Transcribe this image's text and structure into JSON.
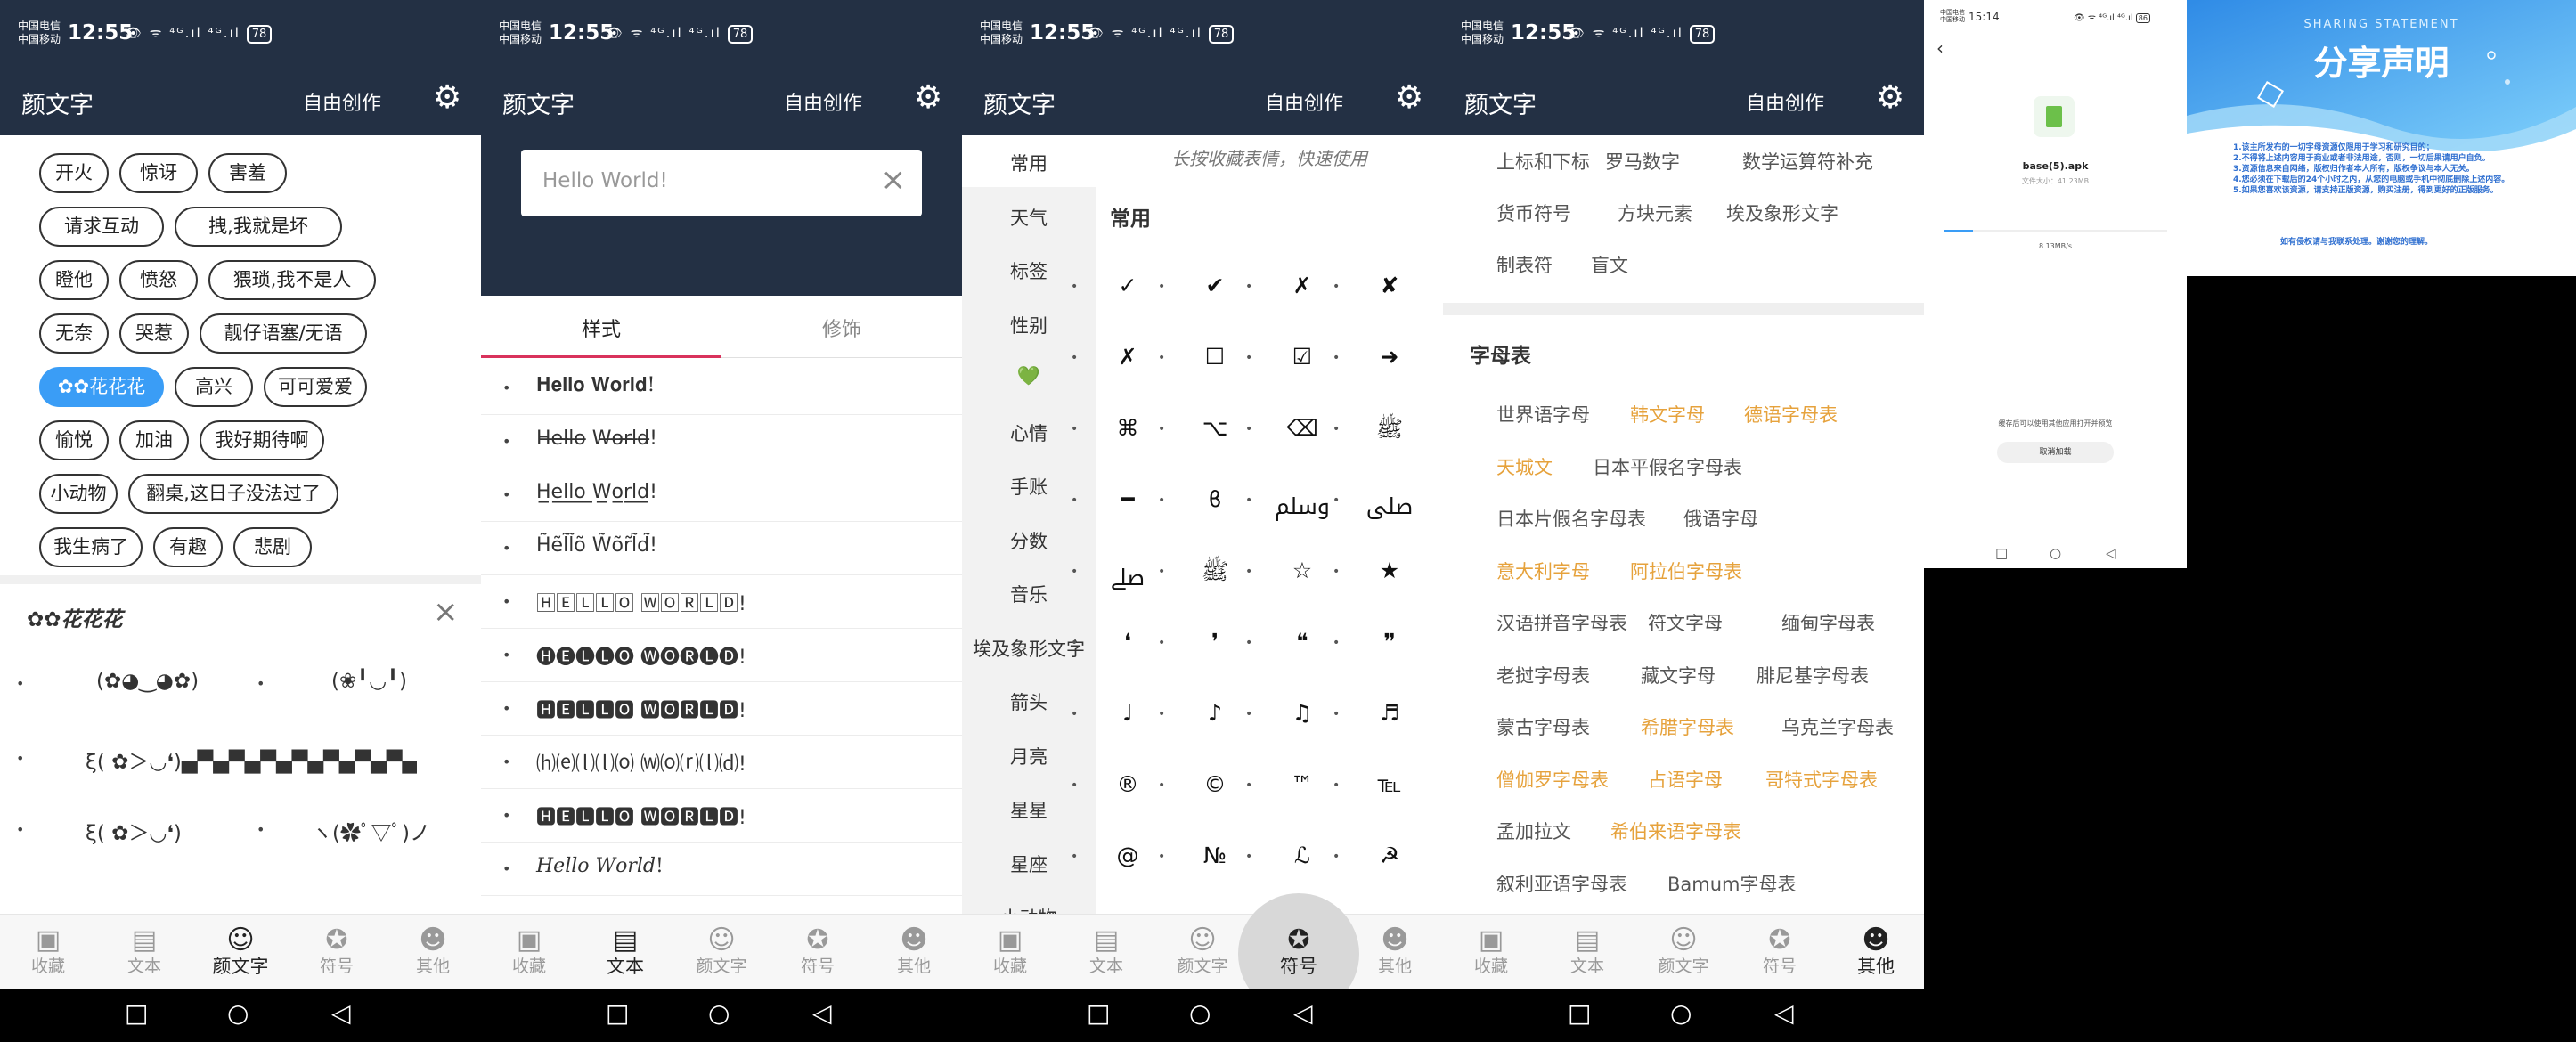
{
  "status": {
    "carrier": "中国电信\n中国移动",
    "time": "12:55",
    "speed1": "4.6\nK/s",
    "speed2": "0.9\nM/s",
    "speed3": "0\nK/s",
    "speed4": "0\nK/s",
    "signal": "👁 ᯤ ⁴ᴳ.ıl ⁴ᴳ.ıl",
    "battery": "78"
  },
  "header": {
    "title": "颜文字",
    "free_create": "自由创作",
    "gear_icon": "⚙"
  },
  "bottom_nav": [
    {
      "label": "收藏",
      "icon": "▣"
    },
    {
      "label": "文本",
      "icon": "▤"
    },
    {
      "label": "颜文字",
      "icon": "☺"
    },
    {
      "label": "符号",
      "icon": "✪"
    },
    {
      "label": "其他",
      "icon": "☻"
    }
  ],
  "sys_nav": {
    "square": "□",
    "circle": "○",
    "back": "◁"
  },
  "screen1": {
    "chips": [
      "开火",
      "惊讶",
      "害羞",
      "请求互动",
      "拽,我就是坏",
      "瞪他",
      "愤怒",
      "猥琐,我不是人",
      "无奈",
      "哭惹",
      "靓仔语塞/无语",
      "✿✿花花花",
      "高兴",
      "可可爱爱",
      "愉悦",
      "加油",
      "我好期待啊",
      "小动物",
      "翻桌,这日子没法过了",
      "我生病了",
      "有趣",
      "悲剧"
    ],
    "panel_title": "✿✿花花花",
    "close": "×",
    "items": [
      "(✿◕‿◕✿)",
      "(❀╹◡╹)",
      "ξ( ✿＞◡❛)▄▀▄▀▄▀▄▀▄▀▄▀▄▀▄",
      "ξ( ✿＞◡❛)",
      "ヽ(✿ﾟ▽ﾟ)ノ"
    ]
  },
  "screen2": {
    "input_value": "Hello World!",
    "clear": "×",
    "tabs": [
      "样式",
      "修饰"
    ],
    "styles": [
      "𝐇𝐞𝐥𝐥𝐨 𝐖𝐨𝐫𝐥𝐝!",
      "H̶e̶l̶l̶o̶ W̶o̶r̶l̶d̶!",
      "H̲e̲l̲l̲o̲ ̲W̲o̲r̲l̲d̲!",
      "H̃ẽl̃l̃õ W̃õr̃l̃d̃!",
      "🄷🄴🄻🄻🄾 🅆🄾🅁🄻🄳!",
      "🅗🅔🅛🅛🅞 🅦🅞🅡🅛🅓!",
      "🅷🅴🅻🅻🅾 🆆🅾🆁🅻🅳!",
      "⒣⒠⒧⒧⒪ ⒲⒪⒭⒧⒟!",
      "🅷🅴🅻🅻🅾 🆆🅾🆁🅻🅳!",
      "𝐻𝑒𝑙𝑙𝑜 𝑊𝑜𝑟𝑙𝑑!"
    ]
  },
  "screen3": {
    "hint": "长按收藏表情，快速使用",
    "categories": [
      "常用",
      "天气",
      "标签",
      "性别",
      "💚",
      "心情",
      "手账",
      "分数",
      "音乐",
      "埃及象形文字",
      "箭头",
      "月亮",
      "星星",
      "星座",
      "小动物"
    ],
    "section": "常用",
    "symbols": [
      "✓",
      "✔",
      "✗",
      "✘",
      "✗",
      "☐",
      "☑",
      "➜",
      "⌘",
      "⌥",
      "⌫",
      "ﷺ",
      "━",
      "ϐ",
      "ﷸ",
      "ﷹ",
      "ﷰ",
      "ﷺ",
      "☆",
      "★",
      "❛",
      "❜",
      "❝",
      "❞",
      "♩",
      "♪",
      "♫",
      "♬",
      "®",
      "©",
      "™",
      "℡",
      "@",
      "№",
      "ℒ",
      "☭",
      "Ɀ",
      "ℬ",
      "☯",
      "☏"
    ]
  },
  "screen4": {
    "top_links": [
      "上标和下标",
      "罗马数字",
      "数学运算符补充",
      "货币符号",
      "方块元素",
      "埃及象形文字",
      "制表符",
      "盲文"
    ],
    "section": "字母表",
    "links": [
      {
        "t": "世界语字母",
        "o": false
      },
      {
        "t": "韩文字母",
        "o": true
      },
      {
        "t": "德语字母表",
        "o": true
      },
      {
        "t": "天城文",
        "o": true
      },
      {
        "t": "日本平假名字母表",
        "o": false
      },
      {
        "t": "日本片假名字母表",
        "o": false
      },
      {
        "t": "俄语字母",
        "o": false
      },
      {
        "t": "意大利字母",
        "o": true
      },
      {
        "t": "阿拉伯字母表",
        "o": true
      },
      {
        "t": "汉语拼音字母表",
        "o": false
      },
      {
        "t": "符文字母",
        "o": false
      },
      {
        "t": "缅甸字母表",
        "o": false
      },
      {
        "t": "老挝字母表",
        "o": false
      },
      {
        "t": "藏文字母",
        "o": false
      },
      {
        "t": "腓尼基字母表",
        "o": false
      },
      {
        "t": "蒙古字母表",
        "o": false
      },
      {
        "t": "希腊字母表",
        "o": true
      },
      {
        "t": "乌克兰字母表",
        "o": false
      },
      {
        "t": "僧伽罗字母表",
        "o": true
      },
      {
        "t": "占语字母",
        "o": true
      },
      {
        "t": "哥特式字母表",
        "o": true
      },
      {
        "t": "孟加拉文",
        "o": false
      },
      {
        "t": "希伯来语字母表",
        "o": true
      },
      {
        "t": "叙利亚语字母表",
        "o": false
      },
      {
        "t": "Bamum字母表",
        "o": false
      }
    ]
  },
  "screen5": {
    "status_time": "15:14",
    "carrier": "中国电信\n中国移动",
    "battery": "86",
    "back": "‹",
    "file_name": "base(5).apk",
    "file_size": "文件大小：41.23MB",
    "speed": "8.13MB/s",
    "notice": "缓存后可以使用其他应用打开并预览",
    "cancel": "取消加载",
    "download_progress": 0.13
  },
  "screen6": {
    "en_title": "SHARING STATEMENT",
    "title": "分享声明",
    "lines": [
      "1.该主所发布的一切字母资源仅限用于学习和研究目的；",
      "2.不得将上述内容用于商业或者非法用途，否则，一切后果请用户自负。",
      "3.资源信息来自网络，版权归作者本人所有，版权争议与本人无关。",
      "4.您必须在下载后的24个小时之内，从您的电脑或手机中彻底删除上述内容。",
      "5.如果您喜欢该资源，请支持正版资源，购买注册，得到更好的正版服务。"
    ],
    "footer": "如有侵权请与我联系处理。谢谢您的理解。"
  },
  "colors": {
    "header": "#233044",
    "accent": "#3a9df6",
    "tab_underline": "#d9325c",
    "orange": "#e6a23c"
  }
}
